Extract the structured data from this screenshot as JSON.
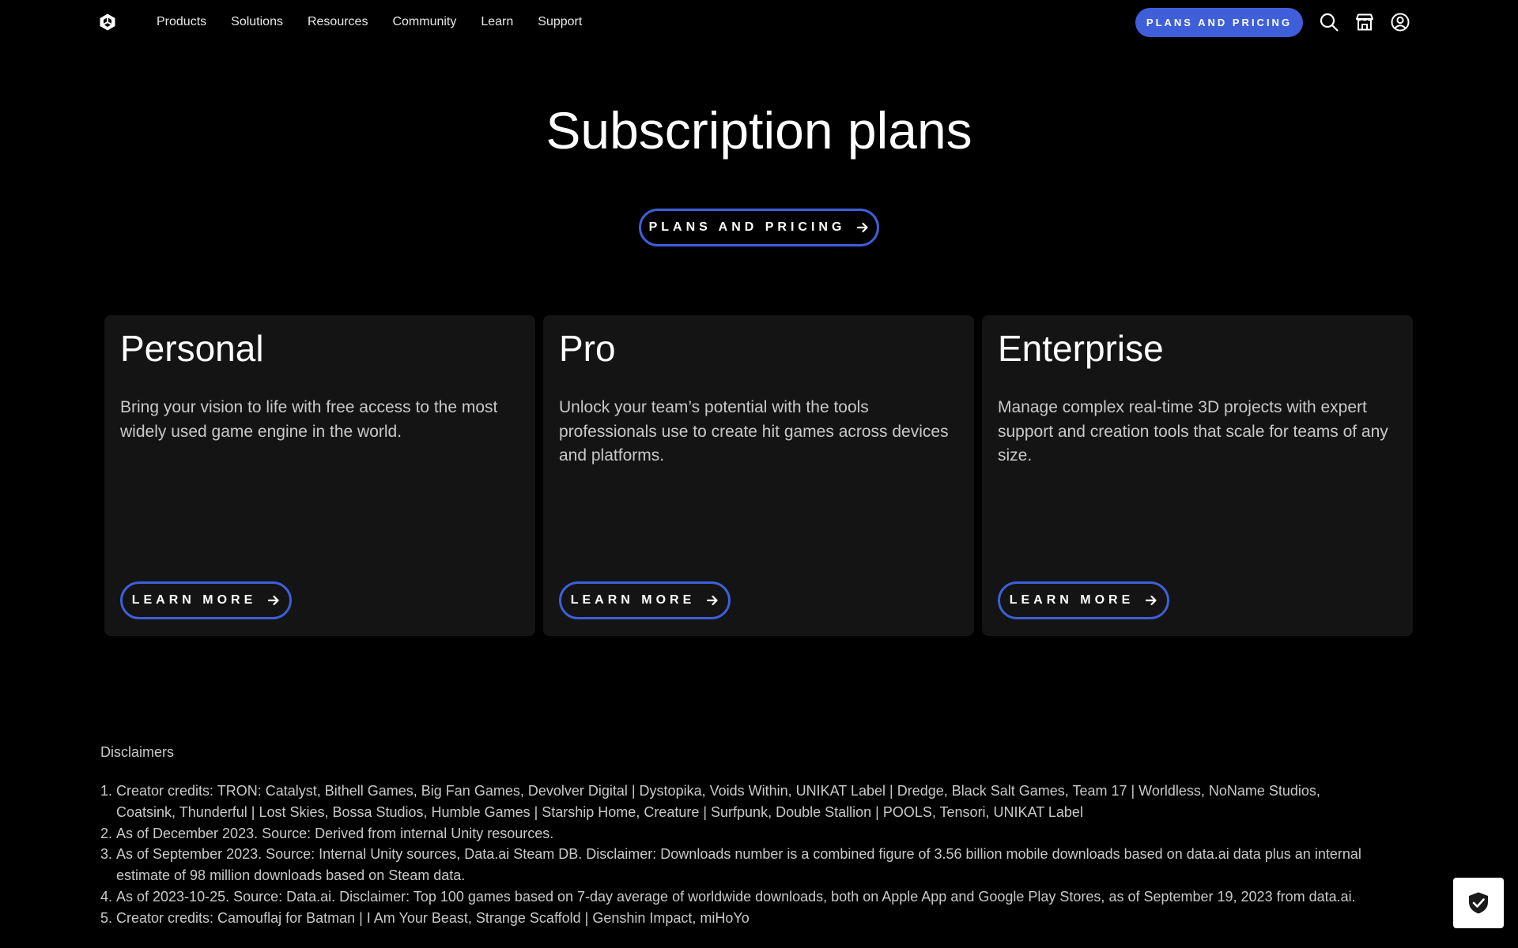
{
  "header": {
    "logo": "unity-logo-icon",
    "nav": [
      {
        "label": "Products"
      },
      {
        "label": "Solutions"
      },
      {
        "label": "Resources"
      },
      {
        "label": "Community"
      },
      {
        "label": "Learn"
      },
      {
        "label": "Support"
      }
    ],
    "cta_label": "PLANS AND PRICING",
    "icons": [
      "search-icon",
      "store-icon",
      "account-icon"
    ],
    "accent_color": "#3e5fd9"
  },
  "hero": {
    "title": "Subscription plans",
    "cta_label": "PLANS AND PRICING"
  },
  "plans": [
    {
      "title": "Personal",
      "description": "Bring your vision to life with free access to the most widely used game engine in the world.",
      "button_label": "LEARN MORE"
    },
    {
      "title": "Pro",
      "description": "Unlock your team’s potential with the tools professionals use to create hit games across devices and platforms.",
      "button_label": "LEARN MORE"
    },
    {
      "title": "Enterprise",
      "description": "Manage complex real-time 3D projects with expert support and creation tools that scale for teams of any size.",
      "button_label": "LEARN MORE"
    }
  ],
  "disclaimers": {
    "title": "Disclaimers",
    "items": [
      "Creator credits: TRON: Catalyst, Bithell Games, Big Fan Games, Devolver Digital | Dystopika, Voids Within, UNIKAT Label | Dredge, Black Salt Games, Team 17 | Worldless, NoName Studios, Coatsink, Thunderful | Lost Skies, Bossa Studios, Humble Games | Starship Home, Creature | Surfpunk, Double Stallion | POOLS, Tensori, UNIKAT Label",
      "As of December 2023. Source: Derived from internal Unity resources.",
      "As of September 2023. Source: Internal Unity sources, Data.ai Steam DB. Disclaimer: Downloads number is a combined figure of 3.56 billion mobile downloads based on data.ai data plus an internal estimate of 98 million downloads based on Steam data.",
      "As of 2023-10-25. Source: Data.ai. Disclaimer: Top 100 games based on 7-day average of worldwide downloads, both on Apple App and Google Play Stores, as of September 19, 2023 from data.ai.",
      "Creator credits: Camouflaj for Batman | I Am Your Beast, Strange Scaffold | Genshin Impact, miHoYo"
    ]
  },
  "privacy_badge": {
    "icon": "shield-check-icon"
  }
}
